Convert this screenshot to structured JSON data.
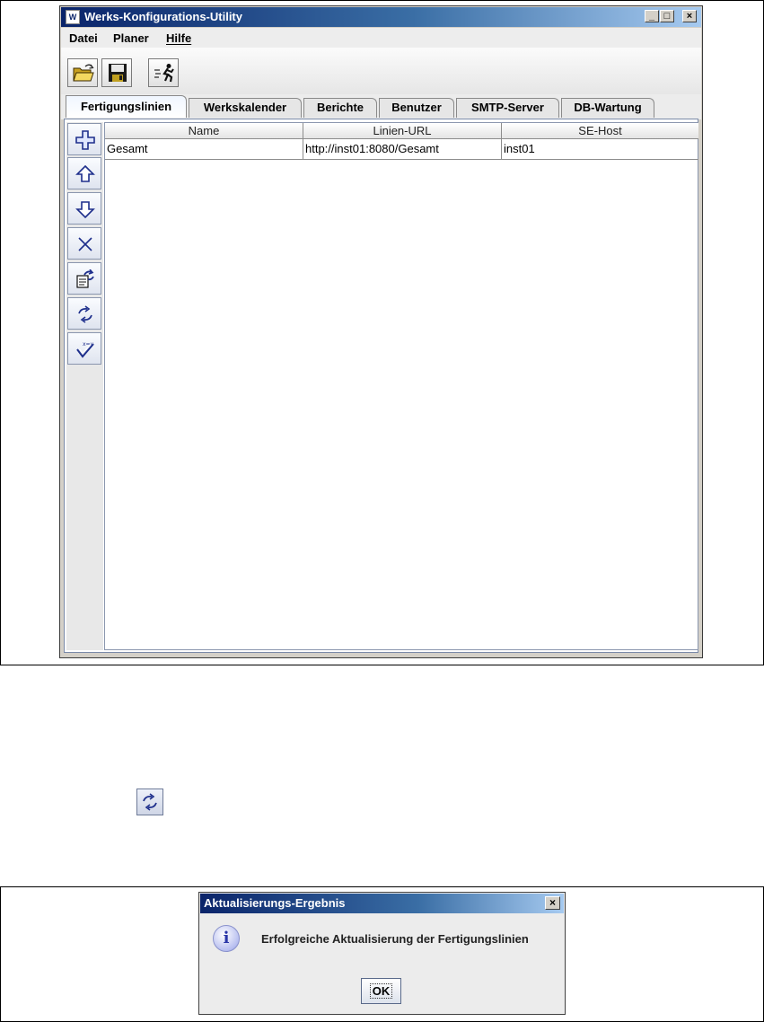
{
  "window": {
    "title": "Werks-Konfigurations-Utility",
    "controls": {
      "minimize": "_",
      "maximize": "□",
      "close": "×"
    }
  },
  "menu": {
    "items": [
      {
        "label": "Datei"
      },
      {
        "label": "Planer"
      },
      {
        "label": "Hilfe"
      }
    ]
  },
  "toolbar": {
    "icons": [
      "open-folder-icon",
      "save-disk-icon",
      "run-icon"
    ]
  },
  "tabs": [
    {
      "label": "Fertigungslinien",
      "active": true
    },
    {
      "label": "Werkskalender"
    },
    {
      "label": "Berichte"
    },
    {
      "label": "Benutzer"
    },
    {
      "label": "SMTP-Server"
    },
    {
      "label": "DB-Wartung"
    }
  ],
  "side_buttons": [
    "add-icon",
    "move-up-icon",
    "move-down-icon",
    "delete-icon",
    "edit-refresh-icon",
    "refresh-icon",
    "check-icon"
  ],
  "table": {
    "columns": [
      "Name",
      "Linien-URL",
      "SE-Host"
    ],
    "rows": [
      [
        "Gesamt",
        "http://inst01:8080/Gesamt",
        "inst01"
      ]
    ]
  },
  "middle_icon": "refresh-icon",
  "dialog": {
    "title": "Aktualisierungs-Ergebnis",
    "close": "×",
    "info_glyph": "i",
    "message": "Erfolgreiche Aktualisierung der Fertigungslinien",
    "ok_label": "OK"
  },
  "colors": {
    "titlebar_start": "#0a246a",
    "titlebar_end": "#a6caf0",
    "window_bg": "#d4d0c8",
    "icon_blue": "#1e2f8c"
  }
}
